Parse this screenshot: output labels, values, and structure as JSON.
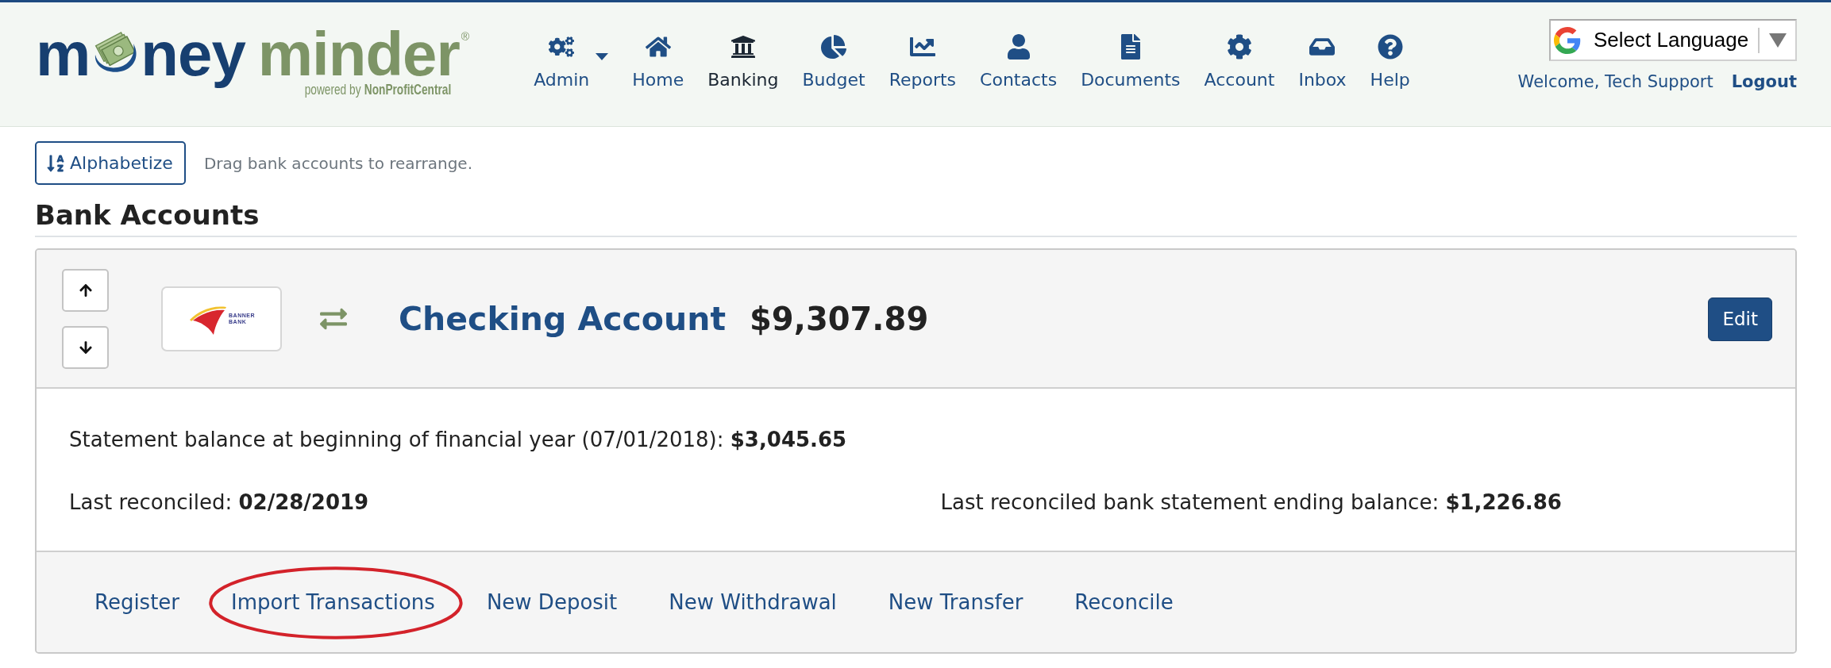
{
  "header": {
    "logo": {
      "word_1_start": "m",
      "word_1_end": "ney",
      "word_2": "minder",
      "registered_mark": "®",
      "tagline": "powered by",
      "tagline_brand": "NonProfitCentral"
    },
    "nav": [
      {
        "label": "Admin",
        "selected": false,
        "dropdown": true
      },
      {
        "label": "Home",
        "selected": false,
        "dropdown": false
      },
      {
        "label": "Banking",
        "selected": true,
        "dropdown": false
      },
      {
        "label": "Budget",
        "selected": false,
        "dropdown": false
      },
      {
        "label": "Reports",
        "selected": false,
        "dropdown": false
      },
      {
        "label": "Contacts",
        "selected": false,
        "dropdown": false
      },
      {
        "label": "Documents",
        "selected": false,
        "dropdown": false
      },
      {
        "label": "Account",
        "selected": false,
        "dropdown": false
      },
      {
        "label": "Inbox",
        "selected": false,
        "dropdown": false
      },
      {
        "label": "Help",
        "selected": false,
        "dropdown": false
      }
    ],
    "language_select": {
      "value": "Select Language"
    },
    "welcome": "Welcome, Tech Support",
    "logout": "Logout"
  },
  "toolbar": {
    "alphabetize_button": "Alphabetize",
    "hint": "Drag bank accounts to rearrange."
  },
  "heading": "Bank Accounts",
  "account": {
    "bank_logo": [
      "BANNER",
      "BANK"
    ],
    "name": "Checking Account",
    "balance": "$9,307.89",
    "edit_button": "Edit",
    "details": [
      "Statement balance at beginning of financial year (07/01/2018): **$3,045.65**",
      "Last reconciled: **02/28/2019**",
      "Last reconciled bank statement ending balance: **$1,226.86**"
    ],
    "links": [
      {
        "label": "Register",
        "circled": false
      },
      {
        "label": "Import Transactions",
        "circled": true
      },
      {
        "label": "New Deposit",
        "circled": false
      },
      {
        "label": "New Withdrawal",
        "circled": false
      },
      {
        "label": "New Transfer",
        "circled": false
      },
      {
        "label": "Reconcile",
        "circled": false
      }
    ]
  }
}
